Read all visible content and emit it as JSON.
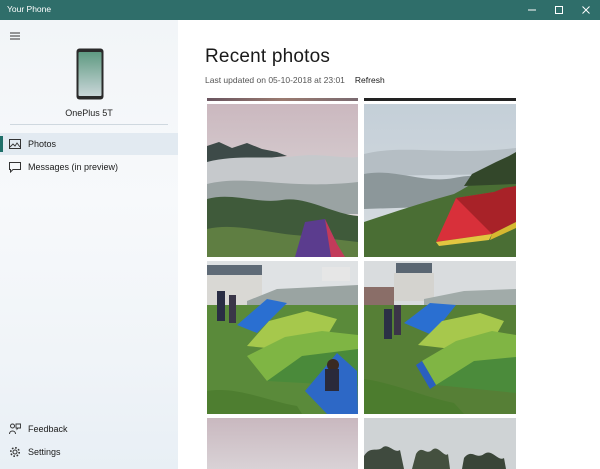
{
  "window": {
    "title": "Your Phone",
    "accent": "#2f6e6a"
  },
  "sidebar": {
    "device_name": "OnePlus 5T",
    "nav": [
      {
        "label": "Photos",
        "icon": "photo-icon",
        "selected": true
      },
      {
        "label": "Messages (in preview)",
        "icon": "message-icon",
        "selected": false
      }
    ],
    "footer": [
      {
        "label": "Feedback",
        "icon": "feedback-icon"
      },
      {
        "label": "Settings",
        "icon": "gear-icon"
      }
    ]
  },
  "main": {
    "title": "Recent photos",
    "last_updated": "Last updated on 05-10-2018 at 23:01",
    "refresh_label": "Refresh",
    "photos": [
      {
        "subject": "foggy mountain valley with purple tent"
      },
      {
        "subject": "red tents on green hill with fog"
      },
      {
        "subject": "blue and green tents at campsite"
      },
      {
        "subject": "green tents and hut at campsite"
      },
      {
        "subject": "overcast sky"
      },
      {
        "subject": "trees under grey sky"
      }
    ]
  }
}
